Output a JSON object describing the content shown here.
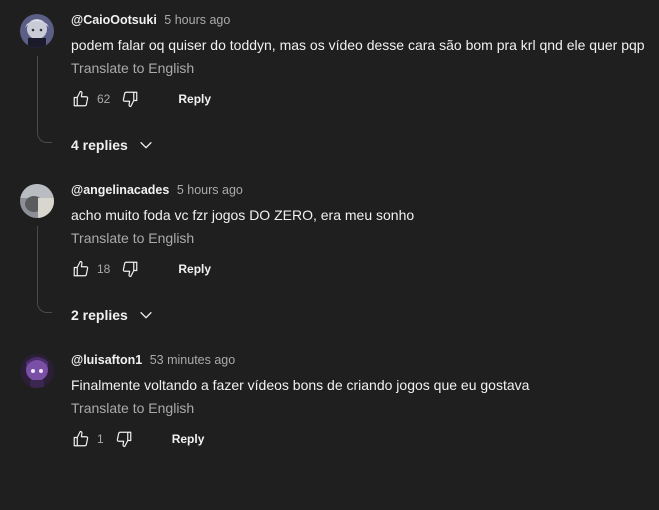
{
  "comments": [
    {
      "author": "@CaioOotsuki",
      "time": "5 hours ago",
      "text": "podem falar oq quiser do toddyn, mas os vídeo desse cara são bom pra krl qnd ele quer pqp",
      "translate_label": "Translate to English",
      "likes": "62",
      "reply_label": "Reply",
      "replies_label": "4 replies",
      "avatar_icon": "anime-character-avatar"
    },
    {
      "author": "@angelinacades",
      "time": "5 hours ago",
      "text": "acho muito foda vc fzr jogos DO ZERO, era meu sonho",
      "translate_label": "Translate to English",
      "likes": "18",
      "reply_label": "Reply",
      "replies_label": "2 replies",
      "avatar_icon": "photo-avatar"
    },
    {
      "author": "@luisafton1",
      "time": "53 minutes ago",
      "text": "Finalmente voltando a fazer vídeos bons de criando jogos que eu gostava",
      "translate_label": "Translate to English",
      "likes": "1",
      "reply_label": "Reply",
      "avatar_icon": "purple-character-avatar"
    }
  ],
  "colors": {
    "background": "#1f1f1f",
    "primary_text": "#f1f1f1",
    "secondary_text": "#aaaaaa",
    "thread_line": "#4a4a4a"
  }
}
